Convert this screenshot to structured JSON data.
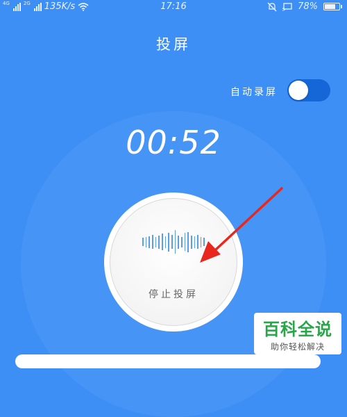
{
  "status_bar": {
    "signal1_label": "4G",
    "signal2_label": "2G",
    "net_speed": "135K/s",
    "time": "17:16",
    "battery": "78%",
    "battery_level": 0.78
  },
  "header": {
    "title": "投屏"
  },
  "auto_record": {
    "label": "自动录屏",
    "enabled": true
  },
  "timer": {
    "value": "00:52"
  },
  "stop_button": {
    "label": "停止投屏",
    "wave_levels": [
      0.35,
      0.45,
      0.5,
      0.6,
      0.45,
      0.55,
      0.7,
      0.5,
      0.8,
      0.6,
      1.0,
      0.55,
      0.45,
      0.75,
      0.85,
      0.55,
      0.5,
      0.6,
      0.45,
      0.35
    ]
  },
  "colors": {
    "background": "#3d8ff5",
    "toggle_track": "#1567d8",
    "wave": "#5a9ee8",
    "arrow": "#e8281e",
    "watermark_text": "#29a448"
  },
  "watermark": {
    "title": "百科全说",
    "subtitle": "助你轻松解决"
  }
}
